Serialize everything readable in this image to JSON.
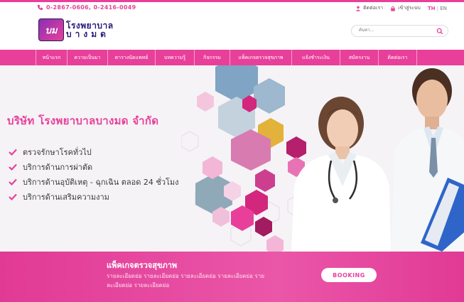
{
  "topbar": {
    "phone": "0-2867-0606, 0-2416-0049",
    "contact_label": "ติดต่อเรา",
    "login_label": "เข้าสู่ระบบ",
    "lang_th": "TH",
    "lang_sep": "|",
    "lang_en": "EN"
  },
  "header": {
    "logo_line1": "โรงพยาบาล",
    "logo_line2": "บางมด",
    "logo_mark": "บม",
    "search_placeholder": "ค้นหา..."
  },
  "nav": {
    "items": [
      "หน้าแรก",
      "ความเป็นมา",
      "ตารางนัดแพทย์",
      "บทความรู้",
      "กิจกรรม",
      "แพ็คเกจตรวจสุขภาพ",
      "แจ้งชำระเงิน",
      "สมัครงาน",
      "ติดต่อเรา"
    ]
  },
  "hero": {
    "title": "บริษัท โรงพยาบาลบางมด จำกัด",
    "services": [
      "ตรวจรักษาโรคทั่วไป",
      "บริการด้านการผ่าตัด",
      "บริการด้านอุบัติเหตุ - ฉุกเฉิน ตลอด 24 ชั่วโมง",
      "บริการด้านเสริมความงาม"
    ]
  },
  "band": {
    "title": "แพ็คเกจตรวจสุขภาพ",
    "desc": "รายละเอียดย่อ รายละเอียดย่อ รายละเอียดย่อ รายละเอียดย่อ รายละเอียดย่อ รายละเอียดย่อ",
    "booking_label": "BOOKING"
  },
  "colors": {
    "accent": "#e8409a",
    "nav": "#e8409a",
    "logo_text": "#2a1a7a"
  }
}
